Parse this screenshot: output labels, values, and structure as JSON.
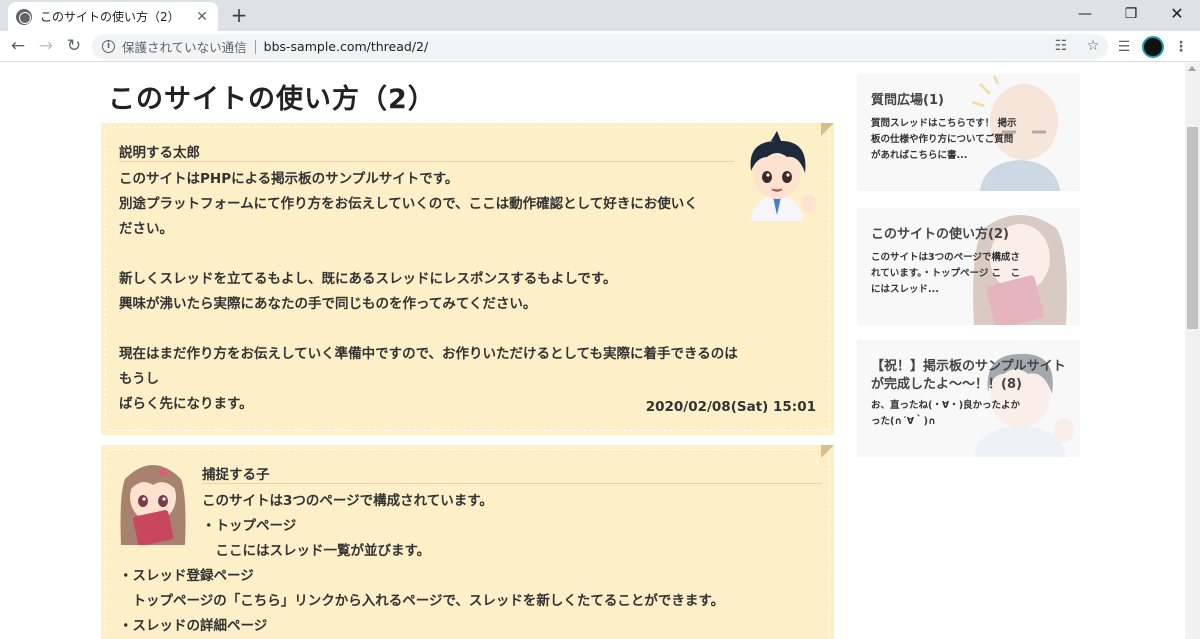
{
  "browser": {
    "tab_title": "このサイトの使い方（2）",
    "tab_close": "✕",
    "new_tab": "+",
    "security_text": "保護されていない通信",
    "url": "bbs-sample.com/thread/2/"
  },
  "thread": {
    "title": "このサイトの使い方（2）",
    "posts": [
      {
        "name": "説明する太郎",
        "body": "このサイトはPHPによる掲示板のサンプルサイトです。\n別途プラットフォームにて作り方をお伝えしていくので、ここは動作確認として好きにお使いく\nださい。\n\n新しくスレッドを立てるもよし、既にあるスレッドにレスポンスするもよしです。\n興味が沸いたら実際にあなたの手で同じものを作ってみてください。\n\n現在はまだ作り方をお伝えしていく準備中ですので、お作りいただけるとしても実際に着手できるのはもうし\nばらく先になります。",
        "date": "2020/02/08(Sat) 15:01"
      },
      {
        "name": "捕捉する子",
        "body_indented": "このサイトは3つのページで構成されています。\n・トップページ\n　ここにはスレッド一覧が並びます。",
        "body_full": "・スレッド登録ページ\n　トップページの「こちら」リンクから入れるページで、スレッドを新しくたてることができます。\n・スレッドの詳細ページ"
      }
    ]
  },
  "sidebar": {
    "cards": [
      {
        "title": "質問広場(1)",
        "desc": "質問スレッドはこちらです！ 掲示板の仕様や作り方についてご質問があればこちらに書..."
      },
      {
        "title": "このサイトの使い方(2)",
        "desc": "このサイトは3つのページで構成されています。・トップページ こ　こにはスレッド..."
      },
      {
        "title": "【祝！】掲示板のサンプルサイトが完成したよ〜〜！！(8)",
        "desc": "お、直ったね(・∀・)良かったよかった(∩´∀｀)∩"
      }
    ]
  },
  "colors": {
    "post_bg": "#fdefc7",
    "card_bg": "#f8f8f8"
  }
}
